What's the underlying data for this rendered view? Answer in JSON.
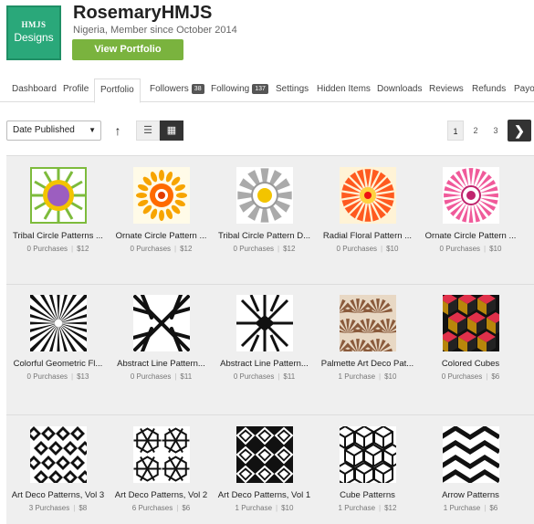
{
  "profile": {
    "logo_line1": "HMJS",
    "logo_line2": "Designs",
    "username": "RosemaryHMJS",
    "subtitle": "Nigeria, Member since October 2014",
    "view_portfolio_label": "View Portfolio"
  },
  "tabs": [
    {
      "label": "Dashboard"
    },
    {
      "label": "Profile"
    },
    {
      "label": "Portfolio",
      "active": true
    },
    {
      "label": "Followers",
      "badge": "38"
    },
    {
      "label": "Following",
      "badge": "137"
    },
    {
      "label": "Settings"
    },
    {
      "label": "Hidden Items"
    },
    {
      "label": "Downloads"
    },
    {
      "label": "Reviews"
    },
    {
      "label": "Refunds"
    },
    {
      "label": "Payo"
    }
  ],
  "toolbar": {
    "sort_value": "Date Published",
    "sort_caret": "▼",
    "sort_dir_icon": "↑",
    "list_icon": "☰",
    "grid_icon": "▦"
  },
  "pagination": {
    "pages": [
      "1",
      "2",
      "3"
    ],
    "current": "1",
    "next_icon": "❯"
  },
  "products": [
    {
      "title": "Tribal Circle Patterns ...",
      "purchases": "0 Purchases",
      "price": "$12",
      "art": "tribal1"
    },
    {
      "title": "Ornate Circle Pattern ...",
      "purchases": "0 Purchases",
      "price": "$12",
      "art": "ornate1"
    },
    {
      "title": "Tribal Circle Pattern D...",
      "purchases": "0 Purchases",
      "price": "$12",
      "art": "tribal2"
    },
    {
      "title": "Radial Floral Pattern ...",
      "purchases": "0 Purchases",
      "price": "$10",
      "art": "radial"
    },
    {
      "title": "Ornate Circle Pattern ...",
      "purchases": "0 Purchases",
      "price": "$10",
      "art": "ornate2"
    },
    {
      "title": "Colorful Geometric Fl...",
      "purchases": "0 Purchases",
      "price": "$13",
      "art": "burst"
    },
    {
      "title": "Abstract Line Pattern...",
      "purchases": "0 Purchases",
      "price": "$11",
      "art": "abstract1"
    },
    {
      "title": "Abstract Line Pattern...",
      "purchases": "0 Purchases",
      "price": "$11",
      "art": "abstract2"
    },
    {
      "title": "Palmette Art Deco Pat...",
      "purchases": "1 Purchase",
      "price": "$10",
      "art": "palmette"
    },
    {
      "title": "Colored Cubes",
      "purchases": "0 Purchases",
      "price": "$6",
      "art": "cubes"
    },
    {
      "title": "Art Deco Patterns, Vol 3",
      "purchases": "3 Purchases",
      "price": "$8",
      "art": "deco3"
    },
    {
      "title": "Art Deco Patterns, Vol 2",
      "purchases": "6 Purchases",
      "price": "$6",
      "art": "deco2"
    },
    {
      "title": "Art Deco Patterns, Vol 1",
      "purchases": "1 Purchase",
      "price": "$10",
      "art": "deco1"
    },
    {
      "title": "Cube Patterns",
      "purchases": "1 Purchase",
      "price": "$12",
      "art": "cubepat"
    },
    {
      "title": "Arrow Patterns",
      "purchases": "1 Purchase",
      "price": "$6",
      "art": "arrows"
    }
  ]
}
